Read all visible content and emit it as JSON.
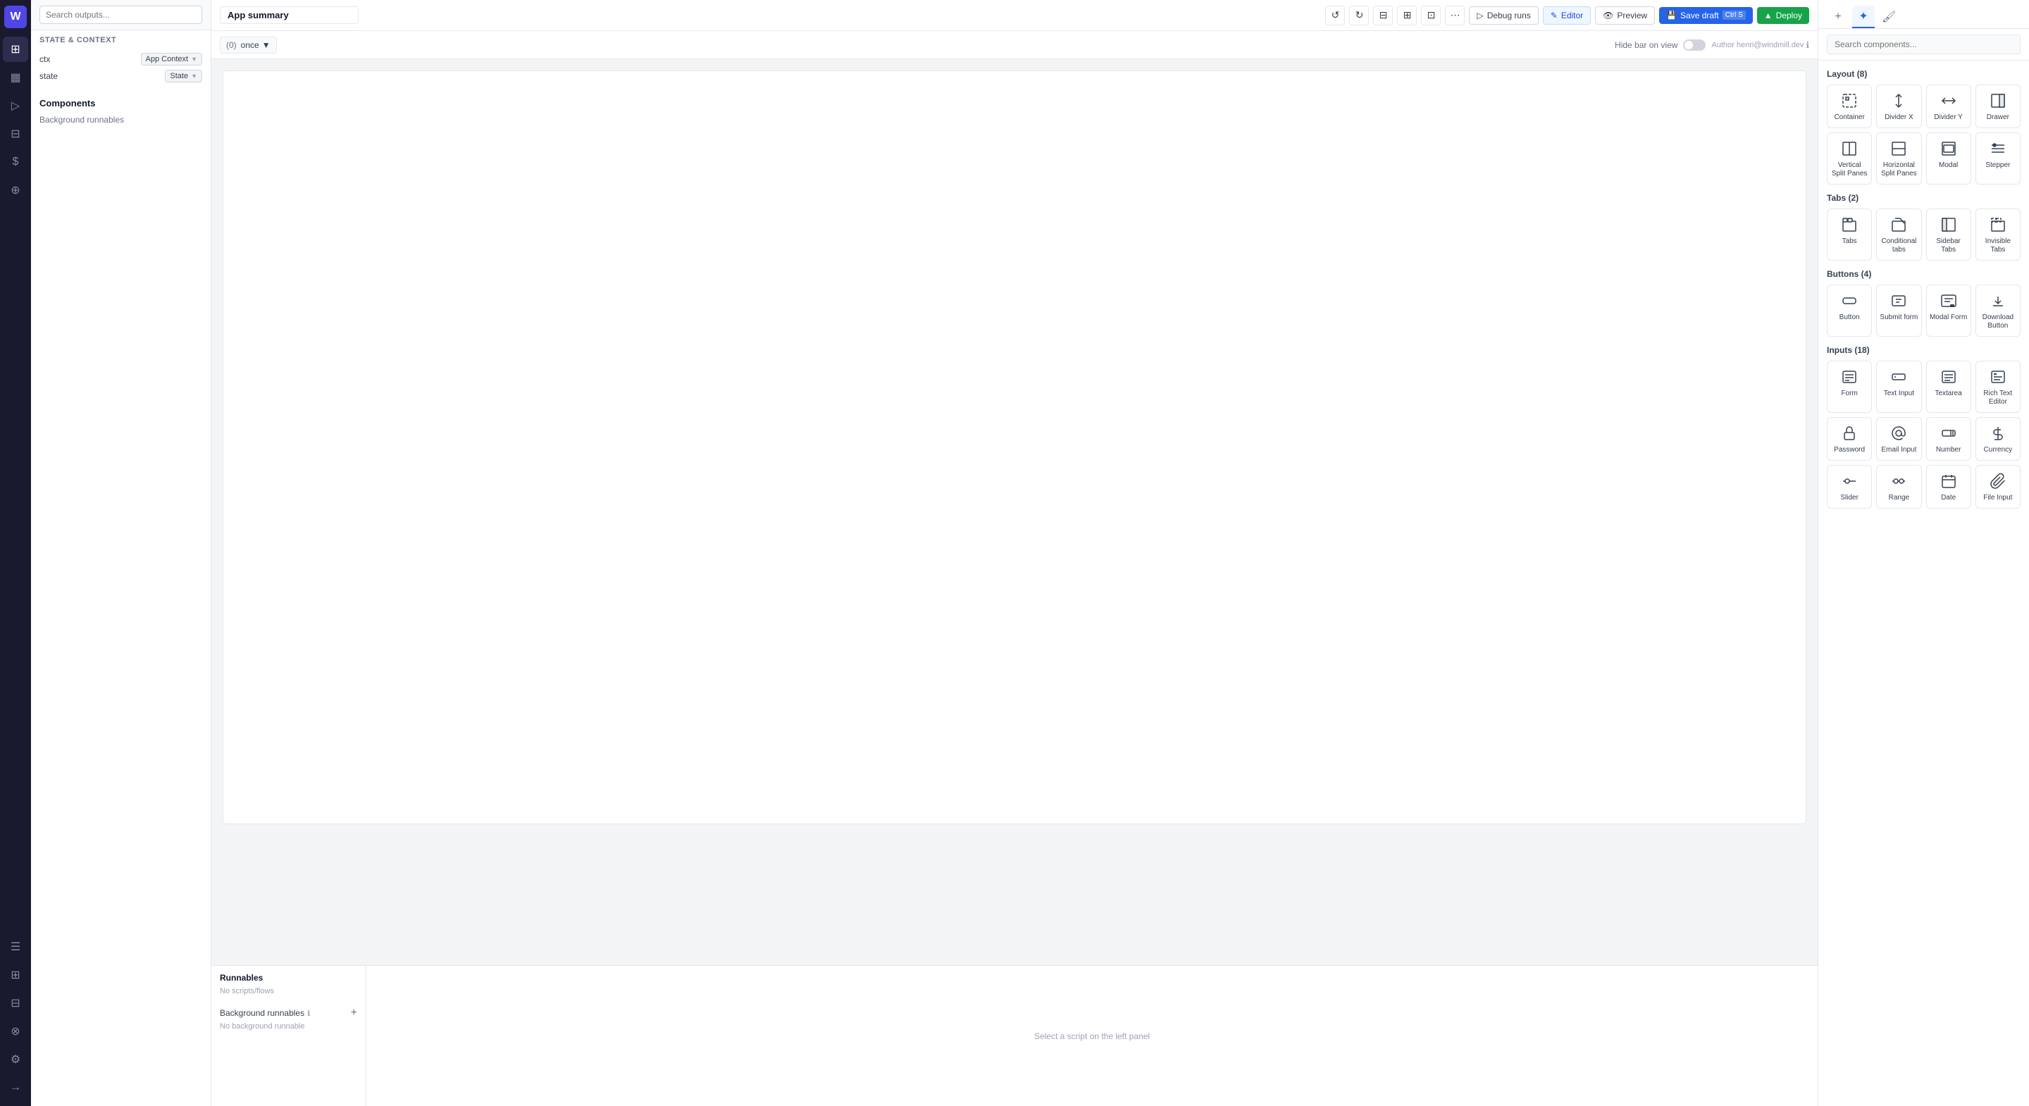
{
  "app": {
    "title": "App summary"
  },
  "topbar": {
    "debug_label": "Debug runs",
    "editor_label": "Editor",
    "preview_label": "Preview",
    "save_label": "Save draft",
    "save_kbd": "Ctrl S",
    "deploy_label": "Deploy"
  },
  "canvas_toolbar": {
    "run_count": "(0)",
    "run_freq": "once",
    "hide_bar_label": "Hide bar on view",
    "author_label": "Author henri@windmill.dev"
  },
  "left_panel": {
    "search_placeholder": "Search outputs...",
    "state_context_title": "State & Context",
    "ctx_label": "ctx",
    "ctx_value": "App Context",
    "state_label": "state",
    "state_value": "State",
    "components_title": "Components",
    "background_runnables_label": "Background runnables"
  },
  "runnables": {
    "title": "Runnables",
    "no_scripts": "No scripts/flows",
    "bg_label": "Background runnables",
    "no_bg": "No background runnable",
    "select_script": "Select a script on the left panel"
  },
  "right_panel": {
    "search_placeholder": "Search components...",
    "layout_section": "Layout (8)",
    "tabs_section": "Tabs (2)",
    "buttons_section": "Buttons (4)",
    "inputs_section": "Inputs (18)",
    "layout_items": [
      {
        "label": "Container",
        "icon": "⊞"
      },
      {
        "label": "Divider X",
        "icon": "⇔"
      },
      {
        "label": "Divider Y",
        "icon": "⇕"
      },
      {
        "label": "Drawer",
        "icon": "▣"
      },
      {
        "label": "Vertical Split Panes",
        "icon": "⊟"
      },
      {
        "label": "Horizontal Split Panes",
        "icon": "⊞"
      },
      {
        "label": "Modal",
        "icon": "▦"
      },
      {
        "label": "Stepper",
        "icon": "☰"
      }
    ],
    "tabs_items": [
      {
        "label": "Tabs",
        "icon": "☰"
      },
      {
        "label": "Conditional tabs",
        "icon": "↗"
      },
      {
        "label": "Sidebar Tabs",
        "icon": "▤"
      },
      {
        "label": "Invisible Tabs",
        "icon": "▣"
      }
    ],
    "buttons_items": [
      {
        "label": "Button",
        "icon": "⬡"
      },
      {
        "label": "Submit form",
        "icon": "▣"
      },
      {
        "label": "Modal Form",
        "icon": "⊞"
      },
      {
        "label": "Download Button",
        "icon": "⬇"
      }
    ],
    "inputs_items": [
      {
        "label": "Form",
        "icon": "📄"
      },
      {
        "label": "Text Input",
        "icon": "⌨"
      },
      {
        "label": "Textarea",
        "icon": "≡"
      },
      {
        "label": "Rich Text Editor",
        "icon": "⇔"
      },
      {
        "label": "Password",
        "icon": "🔒"
      },
      {
        "label": "Email Input",
        "icon": "@"
      },
      {
        "label": "Number",
        "icon": "#"
      },
      {
        "label": "Currency",
        "icon": "$"
      },
      {
        "label": "Slider",
        "icon": "⊟"
      },
      {
        "label": "Range",
        "icon": "⊠"
      },
      {
        "label": "Date",
        "icon": "📅"
      },
      {
        "label": "File Input",
        "icon": "📎"
      }
    ]
  }
}
